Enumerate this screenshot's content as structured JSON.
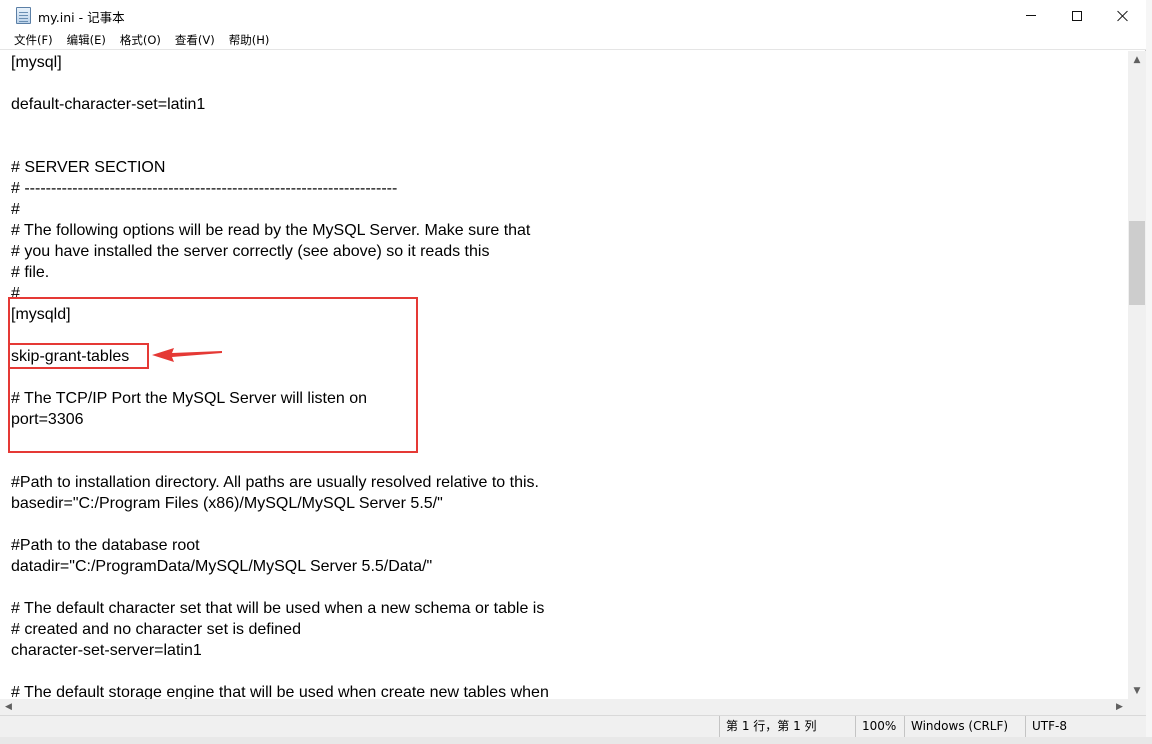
{
  "window": {
    "title": "my.ini - 记事本"
  },
  "menu": [
    {
      "id": "file",
      "label": "文件(F)"
    },
    {
      "id": "edit",
      "label": "编辑(E)"
    },
    {
      "id": "format",
      "label": "格式(O)"
    },
    {
      "id": "view",
      "label": "查看(V)"
    },
    {
      "id": "help",
      "label": "帮助(H)"
    }
  ],
  "editor": {
    "lines": [
      "[mysql]",
      "",
      "default-character-set=latin1",
      "",
      "",
      "# SERVER SECTION",
      "# ----------------------------------------------------------------------",
      "#",
      "# The following options will be read by the MySQL Server. Make sure that",
      "# you have installed the server correctly (see above) so it reads this",
      "# file.",
      "#",
      "[mysqld]",
      "",
      "skip-grant-tables",
      "",
      "# The TCP/IP Port the MySQL Server will listen on",
      "port=3306",
      "",
      "",
      "#Path to installation directory. All paths are usually resolved relative to this.",
      "basedir=\"C:/Program Files (x86)/MySQL/MySQL Server 5.5/\"",
      "",
      "#Path to the database root",
      "datadir=\"C:/ProgramData/MySQL/MySQL Server 5.5/Data/\"",
      "",
      "# The default character set that will be used when a new schema or table is",
      "# created and no character set is defined",
      "character-set-server=latin1",
      "",
      "# The default storage engine that will be used when create new tables when"
    ]
  },
  "status": {
    "position": "第 1 行，第 1 列",
    "zoom": "100%",
    "line_ending": "Windows (CRLF)",
    "encoding": "UTF-8"
  },
  "colors": {
    "highlight": "#e53935"
  }
}
